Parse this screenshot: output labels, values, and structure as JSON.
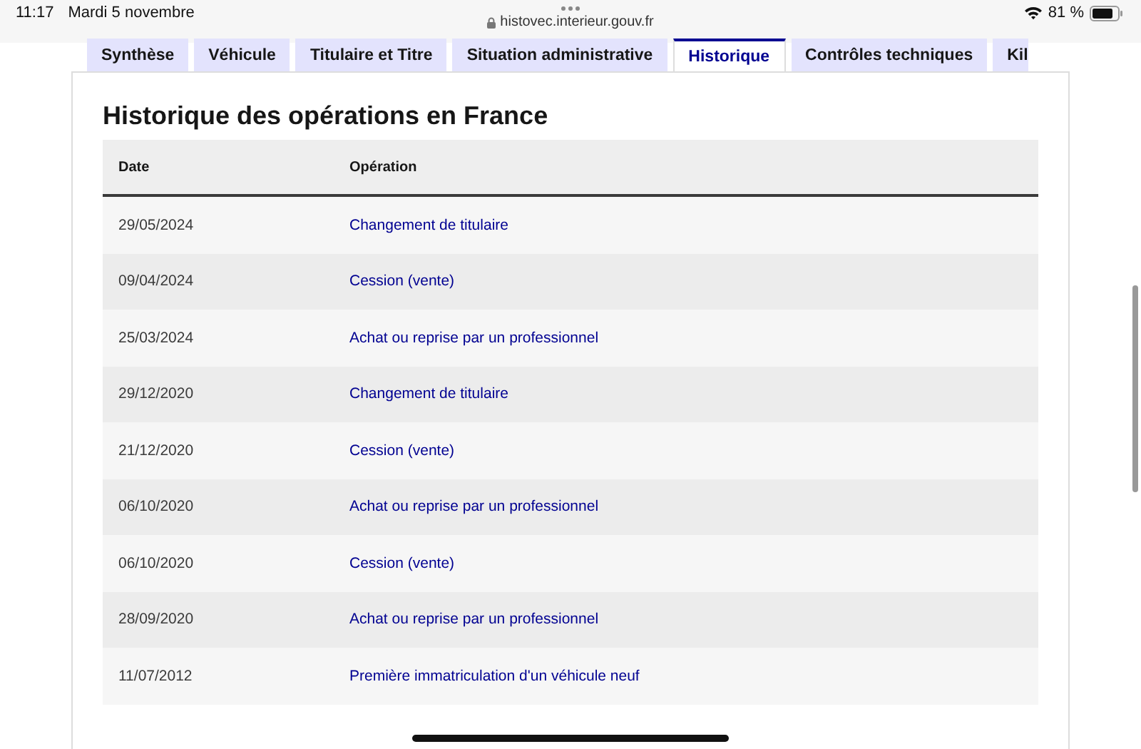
{
  "status_bar": {
    "time": "11:17",
    "date": "Mardi 5 novembre",
    "url": "histovec.interieur.gouv.fr",
    "battery": "81 %"
  },
  "tabs": [
    {
      "label": "Synthèse",
      "selected": false,
      "cut": false
    },
    {
      "label": "Véhicule",
      "selected": false,
      "cut": false
    },
    {
      "label": "Titulaire et Titre",
      "selected": false,
      "cut": false
    },
    {
      "label": "Situation administrative",
      "selected": false,
      "cut": false
    },
    {
      "label": "Historique",
      "selected": true,
      "cut": false
    },
    {
      "label": "Contrôles techniques",
      "selected": false,
      "cut": false
    },
    {
      "label": "Kil",
      "selected": false,
      "cut": true
    }
  ],
  "title": "Historique des opérations en France",
  "table": {
    "columns": [
      "Date",
      "Opération"
    ],
    "rows": [
      {
        "date": "29/05/2024",
        "operation": "Changement de titulaire"
      },
      {
        "date": "09/04/2024",
        "operation": "Cession (vente)"
      },
      {
        "date": "25/03/2024",
        "operation": "Achat ou reprise par un professionnel"
      },
      {
        "date": "29/12/2020",
        "operation": "Changement de titulaire"
      },
      {
        "date": "21/12/2020",
        "operation": "Cession (vente)"
      },
      {
        "date": "06/10/2020",
        "operation": "Achat ou reprise par un professionnel"
      },
      {
        "date": "06/10/2020",
        "operation": "Cession (vente)"
      },
      {
        "date": "28/09/2020",
        "operation": "Achat ou reprise par un professionnel"
      },
      {
        "date": "11/07/2012",
        "operation": "Première immatriculation d'un véhicule neuf"
      }
    ]
  }
}
